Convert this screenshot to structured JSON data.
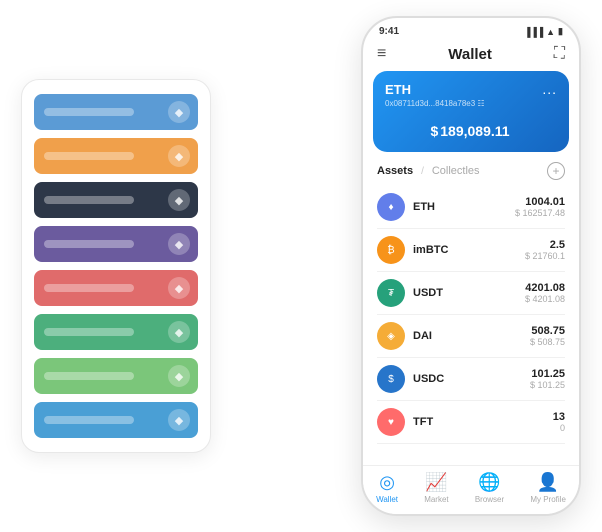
{
  "scene": {
    "left_panel": {
      "cards": [
        {
          "color": "card-blue",
          "icon": "◆"
        },
        {
          "color": "card-orange",
          "icon": "◆"
        },
        {
          "color": "card-dark",
          "icon": "◆"
        },
        {
          "color": "card-purple",
          "icon": "◆"
        },
        {
          "color": "card-red",
          "icon": "◆"
        },
        {
          "color": "card-green",
          "icon": "◆"
        },
        {
          "color": "card-light-green",
          "icon": "◆"
        },
        {
          "color": "card-blue2",
          "icon": "◆"
        }
      ]
    },
    "phone": {
      "status_bar": {
        "time": "9:41",
        "signal": "▐▐▐",
        "wifi": "▲",
        "battery": "▮"
      },
      "header": {
        "menu_icon": "≡",
        "title": "Wallet",
        "scan_icon": "⛶"
      },
      "eth_card": {
        "title": "ETH",
        "address": "0x08711d3d...8418a78e3 ☷",
        "more": "...",
        "currency": "$",
        "balance": "189,089.11"
      },
      "assets_section": {
        "tab_active": "Assets",
        "tab_divider": "/",
        "tab_inactive": "Collectles",
        "add_icon": "+"
      },
      "assets": [
        {
          "name": "ETH",
          "icon_label": "♦",
          "icon_class": "eth-icon",
          "amount": "1004.01",
          "usd": "$ 162517.48"
        },
        {
          "name": "imBTC",
          "icon_label": "₿",
          "icon_class": "imbtc-icon",
          "amount": "2.5",
          "usd": "$ 21760.1"
        },
        {
          "name": "USDT",
          "icon_label": "₮",
          "icon_class": "usdt-icon",
          "amount": "4201.08",
          "usd": "$ 4201.08"
        },
        {
          "name": "DAI",
          "icon_label": "◈",
          "icon_class": "dai-icon",
          "amount": "508.75",
          "usd": "$ 508.75"
        },
        {
          "name": "USDC",
          "icon_label": "$",
          "icon_class": "usdc-icon",
          "amount": "101.25",
          "usd": "$ 101.25"
        },
        {
          "name": "TFT",
          "icon_label": "♥",
          "icon_class": "tft-icon",
          "amount": "13",
          "usd": "0"
        }
      ],
      "nav": [
        {
          "icon": "◎",
          "label": "Wallet",
          "active": true
        },
        {
          "icon": "📊",
          "label": "Market",
          "active": false
        },
        {
          "icon": "🌐",
          "label": "Browser",
          "active": false
        },
        {
          "icon": "👤",
          "label": "My Profile",
          "active": false
        }
      ]
    }
  }
}
